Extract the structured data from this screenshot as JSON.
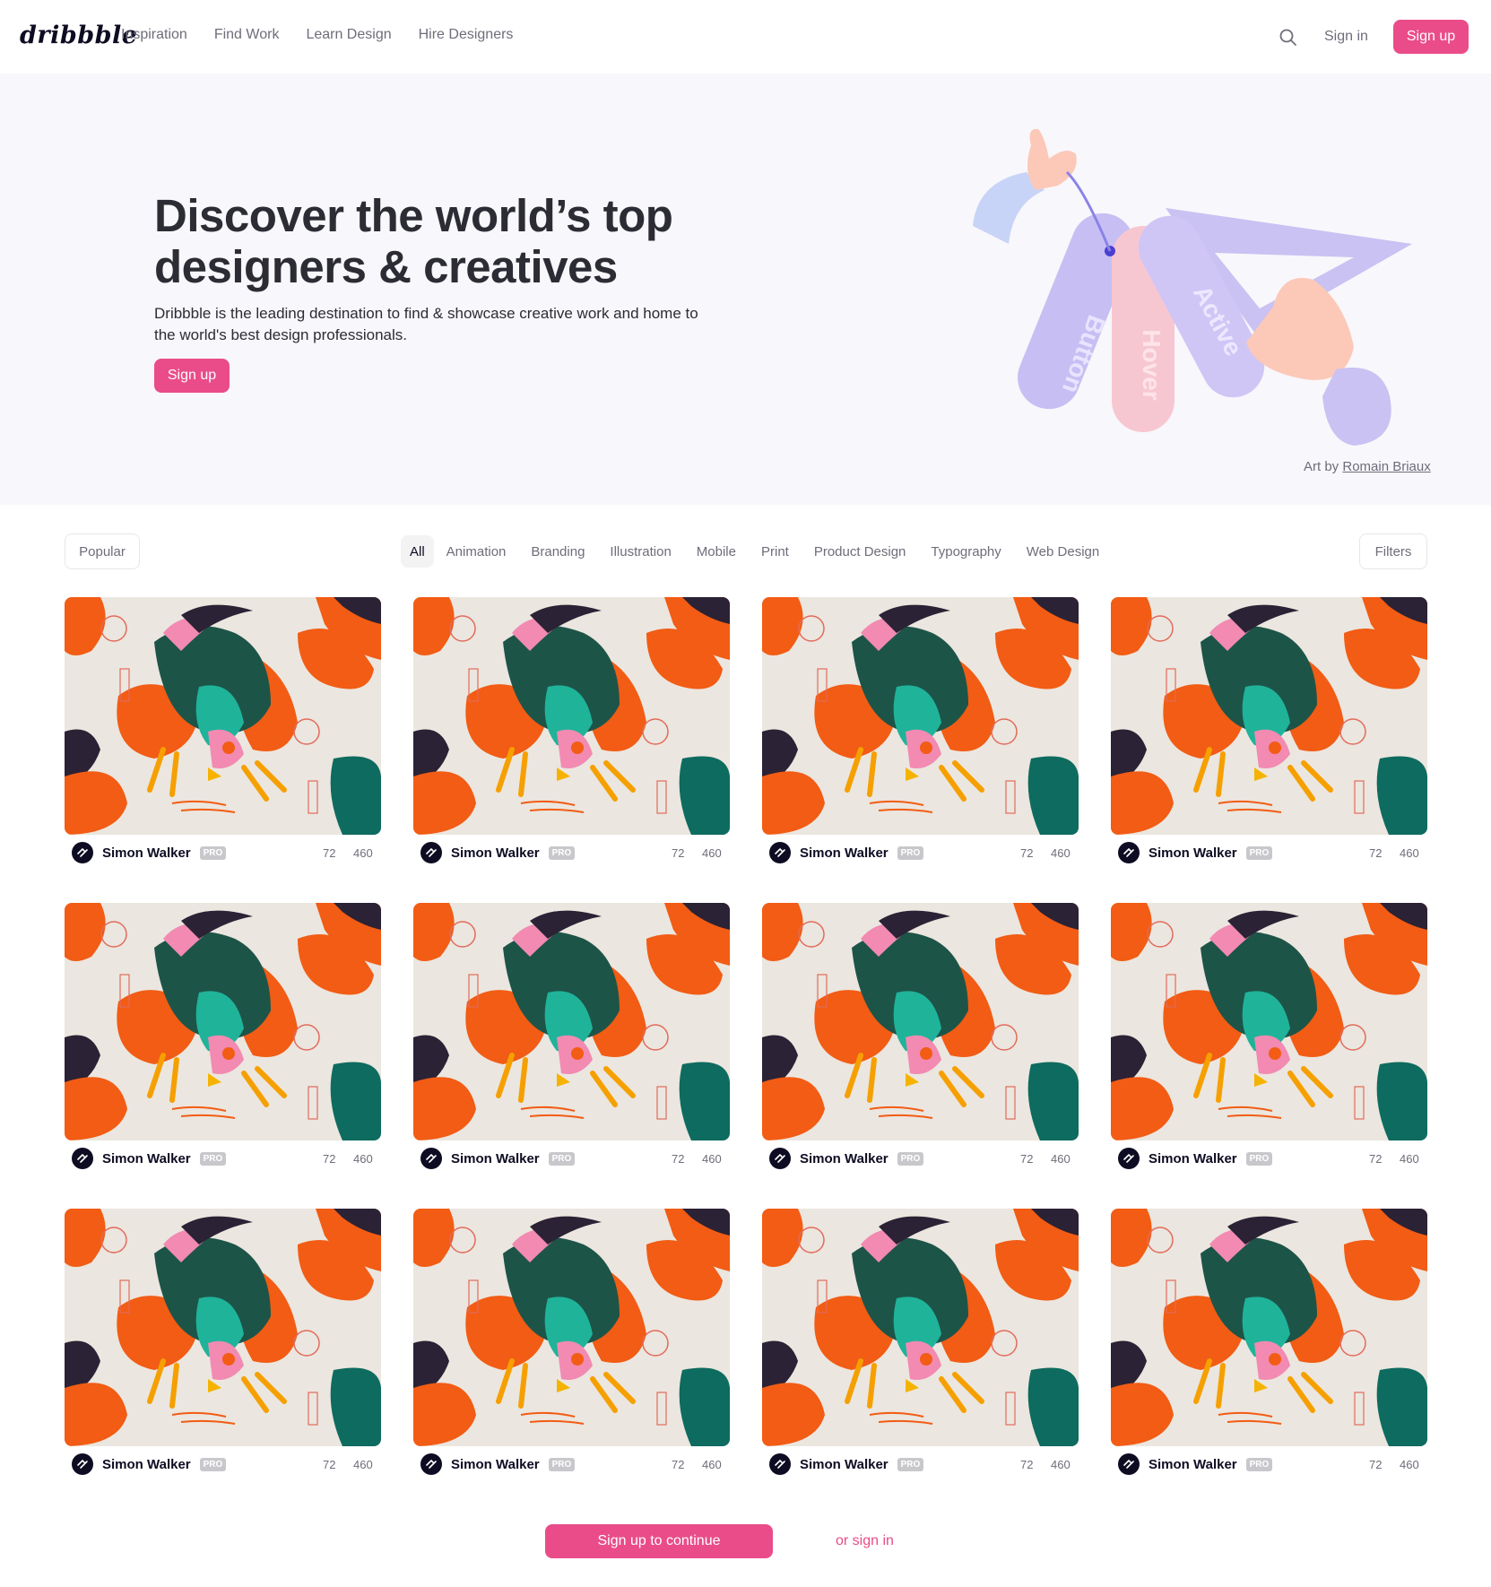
{
  "header": {
    "logo": "dribbble",
    "nav": [
      "Inspiration",
      "Find Work",
      "Learn Design",
      "Hire Designers"
    ],
    "sign_in": "Sign in",
    "sign_up": "Sign up"
  },
  "hero": {
    "title": "Discover the world’s top designers & creatives",
    "subtitle": "Dribbble is the leading destination to find & showcase creative work and home to the world's best design professionals.",
    "cta": "Sign up",
    "art_tags": [
      "Button",
      "Hover",
      "Active"
    ],
    "art_credit_prefix": "Art by",
    "art_credit_name": "Romain Briaux"
  },
  "filters": {
    "sort": "Popular",
    "categories": [
      "All",
      "Animation",
      "Branding",
      "Illustration",
      "Mobile",
      "Print",
      "Product Design",
      "Typography",
      "Web Design"
    ],
    "active_category": "All",
    "filters_label": "Filters"
  },
  "shots": [
    {
      "author": "Simon Walker",
      "badge": "PRO",
      "likes": "72",
      "views": "460"
    },
    {
      "author": "Simon Walker",
      "badge": "PRO",
      "likes": "72",
      "views": "460"
    },
    {
      "author": "Simon Walker",
      "badge": "PRO",
      "likes": "72",
      "views": "460"
    },
    {
      "author": "Simon Walker",
      "badge": "PRO",
      "likes": "72",
      "views": "460"
    },
    {
      "author": "Simon Walker",
      "badge": "PRO",
      "likes": "72",
      "views": "460"
    },
    {
      "author": "Simon Walker",
      "badge": "PRO",
      "likes": "72",
      "views": "460"
    },
    {
      "author": "Simon Walker",
      "badge": "PRO",
      "likes": "72",
      "views": "460"
    },
    {
      "author": "Simon Walker",
      "badge": "PRO",
      "likes": "72",
      "views": "460"
    },
    {
      "author": "Simon Walker",
      "badge": "PRO",
      "likes": "72",
      "views": "460"
    },
    {
      "author": "Simon Walker",
      "badge": "PRO",
      "likes": "72",
      "views": "460"
    },
    {
      "author": "Simon Walker",
      "badge": "PRO",
      "likes": "72",
      "views": "460"
    },
    {
      "author": "Simon Walker",
      "badge": "PRO",
      "likes": "72",
      "views": "460"
    }
  ],
  "footer_cta": {
    "sign_up": "Sign up to continue",
    "or_sign_in": "or sign in"
  },
  "colors": {
    "accent": "#ea4c89",
    "hero_bg": "#f8f7fb",
    "text_dark": "#0d0c22",
    "text_muted": "#6e6d7a"
  }
}
